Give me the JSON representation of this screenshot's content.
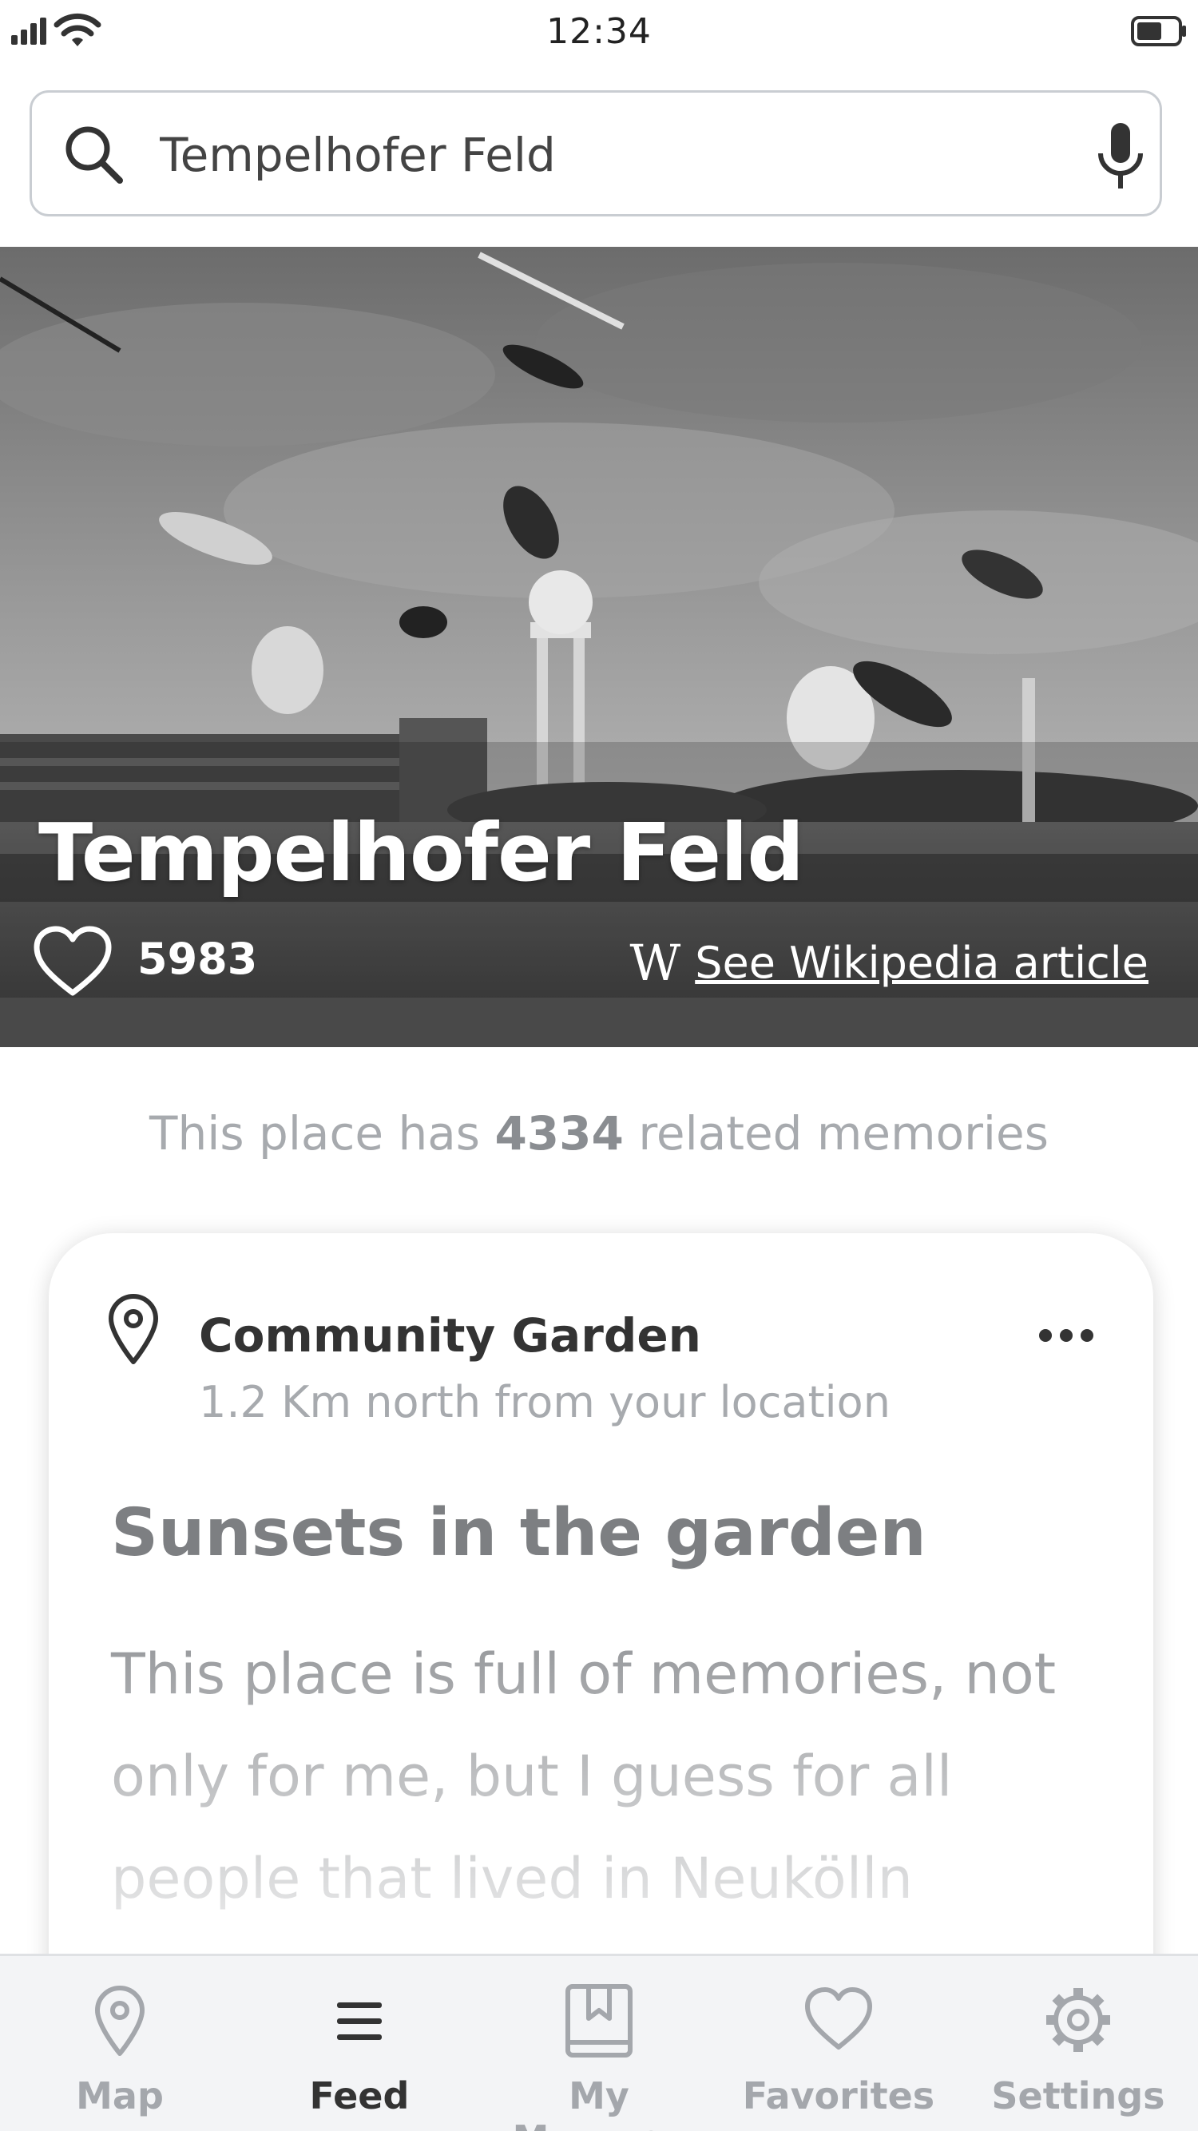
{
  "status_bar": {
    "time": "12:34"
  },
  "search": {
    "value": "Tempelhofer Feld"
  },
  "hero": {
    "title": "Tempelhofer Feld",
    "likes": "5983",
    "wiki_icon": "W",
    "wiki_link": "See Wikipedia article"
  },
  "related": {
    "prefix": "This place has ",
    "count": "4334",
    "suffix": " related memories"
  },
  "card": {
    "place_name": "Community Garden",
    "distance": "1.2 Km north from your location",
    "memory_title": "Sunsets in the garden",
    "memory_body": "This place is full of memories, not only for me, but I guess for all people that lived in Neukölln"
  },
  "tabs": [
    {
      "label": "Map",
      "icon": "map-pin-icon",
      "active": false
    },
    {
      "label": "Feed",
      "icon": "feed-icon",
      "active": true
    },
    {
      "label": "My Mnemos",
      "icon": "bookmark-book-icon",
      "active": false
    },
    {
      "label": "Favorites",
      "icon": "heart-icon",
      "active": false
    },
    {
      "label": "Settings",
      "icon": "gear-icon",
      "active": false
    }
  ],
  "colors": {
    "accent_active": "#333333",
    "inactive": "#a4a7ac",
    "muted_text": "#a7aaae"
  }
}
